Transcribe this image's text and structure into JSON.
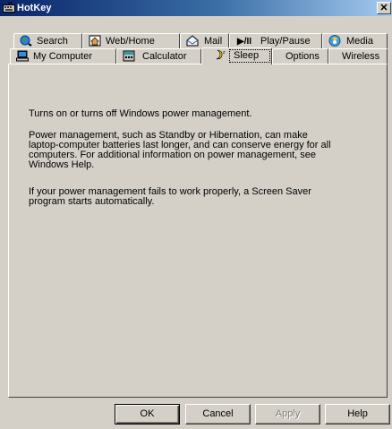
{
  "window": {
    "title": "HotKey",
    "close_glyph": "✕"
  },
  "tabs_row1": [
    {
      "label": "Search",
      "icon": "search-globe-icon"
    },
    {
      "label": "Web/Home",
      "icon": "home-icon"
    },
    {
      "label": "Mail",
      "icon": "mail-icon"
    },
    {
      "label": "Play/Pause",
      "glyph": "▶/II",
      "icon": "play-pause-icon"
    },
    {
      "label": "Media",
      "icon": "media-icon"
    }
  ],
  "tabs_row2": [
    {
      "label": "My Computer",
      "icon": "computer-icon"
    },
    {
      "label": "Calculator",
      "icon": "calculator-icon"
    },
    {
      "label": "Sleep",
      "icon": "sleep-icon",
      "selected": true
    },
    {
      "label": "Options"
    },
    {
      "label": "Wireless"
    }
  ],
  "content": {
    "paragraph1": "Turns on or turns off Windows power management.",
    "paragraph2_lines": [
      "Power management, such as Standby or Hibernation, can make",
      "laptop-computer batteries last longer, and can conserve energy for all",
      "computers. For additional information on power management, see",
      "Windows Help."
    ],
    "paragraph3_lines": [
      "If your power management fails to work properly, a Screen Saver",
      "program starts automatically."
    ]
  },
  "buttons": {
    "ok": "OK",
    "cancel": "Cancel",
    "apply": "Apply",
    "help": "Help"
  },
  "colors": {
    "face": "#d4d0c8",
    "title_start": "#0a246a",
    "title_end": "#a6caf0",
    "disabled_text": "#808080"
  }
}
